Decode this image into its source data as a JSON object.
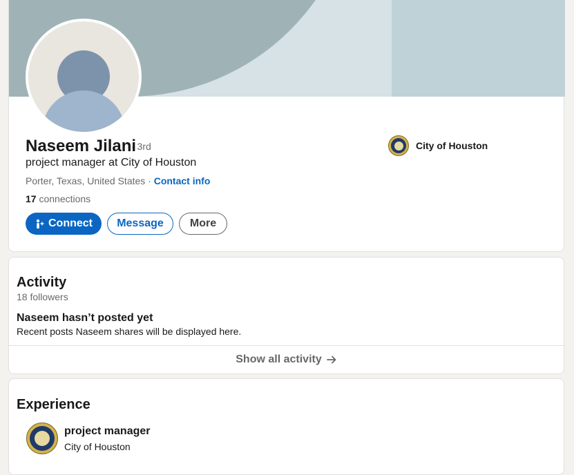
{
  "profile": {
    "name": "Naseem Jilani",
    "degree": "· 3rd",
    "headline": "project manager at City of Houston",
    "location": "Porter, Texas, United States · ",
    "contact_info": "Contact info",
    "connections_count": "17",
    "connections_label": " connections",
    "company_name": "City of Houston"
  },
  "actions": {
    "connect_label": "Connect",
    "message_label": "Message",
    "more_label": "More"
  },
  "activity": {
    "title": "Activity",
    "followers": "18 followers",
    "empty_title": "Naseem hasn’t posted yet",
    "empty_text": "Recent posts Naseem shares will be displayed here.",
    "show_all": "Show all activity"
  },
  "experience": {
    "title": "Experience",
    "items": [
      {
        "role": "project manager",
        "company": "City of Houston",
        "logo_icon": "city-of-houston-seal-icon"
      }
    ]
  },
  "colors": {
    "accent": "#0a66c2",
    "page_background": "#f4f2ee",
    "banner_light": "#d6e2e5",
    "banner_dark": "#9fb3b7",
    "banner_right": "#bfd2d8"
  }
}
